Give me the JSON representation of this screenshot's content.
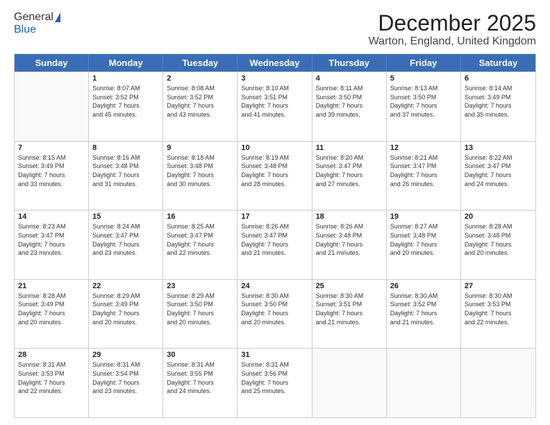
{
  "header": {
    "logo_general": "General",
    "logo_blue": "Blue",
    "month": "December 2025",
    "location": "Warton, England, United Kingdom"
  },
  "days_of_week": [
    "Sunday",
    "Monday",
    "Tuesday",
    "Wednesday",
    "Thursday",
    "Friday",
    "Saturday"
  ],
  "weeks": [
    [
      {
        "day": "",
        "lines": []
      },
      {
        "day": "1",
        "lines": [
          "Sunrise: 8:07 AM",
          "Sunset: 3:52 PM",
          "Daylight: 7 hours",
          "and 45 minutes."
        ]
      },
      {
        "day": "2",
        "lines": [
          "Sunrise: 8:08 AM",
          "Sunset: 3:52 PM",
          "Daylight: 7 hours",
          "and 43 minutes."
        ]
      },
      {
        "day": "3",
        "lines": [
          "Sunrise: 8:10 AM",
          "Sunset: 3:51 PM",
          "Daylight: 7 hours",
          "and 41 minutes."
        ]
      },
      {
        "day": "4",
        "lines": [
          "Sunrise: 8:11 AM",
          "Sunset: 3:50 PM",
          "Daylight: 7 hours",
          "and 39 minutes."
        ]
      },
      {
        "day": "5",
        "lines": [
          "Sunrise: 8:13 AM",
          "Sunset: 3:50 PM",
          "Daylight: 7 hours",
          "and 37 minutes."
        ]
      },
      {
        "day": "6",
        "lines": [
          "Sunrise: 8:14 AM",
          "Sunset: 3:49 PM",
          "Daylight: 7 hours",
          "and 35 minutes."
        ]
      }
    ],
    [
      {
        "day": "7",
        "lines": [
          "Sunrise: 8:15 AM",
          "Sunset: 3:49 PM",
          "Daylight: 7 hours",
          "and 33 minutes."
        ]
      },
      {
        "day": "8",
        "lines": [
          "Sunrise: 8:16 AM",
          "Sunset: 3:48 PM",
          "Daylight: 7 hours",
          "and 31 minutes."
        ]
      },
      {
        "day": "9",
        "lines": [
          "Sunrise: 8:18 AM",
          "Sunset: 3:48 PM",
          "Daylight: 7 hours",
          "and 30 minutes."
        ]
      },
      {
        "day": "10",
        "lines": [
          "Sunrise: 8:19 AM",
          "Sunset: 3:48 PM",
          "Daylight: 7 hours",
          "and 28 minutes."
        ]
      },
      {
        "day": "11",
        "lines": [
          "Sunrise: 8:20 AM",
          "Sunset: 3:47 PM",
          "Daylight: 7 hours",
          "and 27 minutes."
        ]
      },
      {
        "day": "12",
        "lines": [
          "Sunrise: 8:21 AM",
          "Sunset: 3:47 PM",
          "Daylight: 7 hours",
          "and 26 minutes."
        ]
      },
      {
        "day": "13",
        "lines": [
          "Sunrise: 8:22 AM",
          "Sunset: 3:47 PM",
          "Daylight: 7 hours",
          "and 24 minutes."
        ]
      }
    ],
    [
      {
        "day": "14",
        "lines": [
          "Sunrise: 8:23 AM",
          "Sunset: 3:47 PM",
          "Daylight: 7 hours",
          "and 23 minutes."
        ]
      },
      {
        "day": "15",
        "lines": [
          "Sunrise: 8:24 AM",
          "Sunset: 3:47 PM",
          "Daylight: 7 hours",
          "and 23 minutes."
        ]
      },
      {
        "day": "16",
        "lines": [
          "Sunrise: 8:25 AM",
          "Sunset: 3:47 PM",
          "Daylight: 7 hours",
          "and 22 minutes."
        ]
      },
      {
        "day": "17",
        "lines": [
          "Sunrise: 8:26 AM",
          "Sunset: 3:47 PM",
          "Daylight: 7 hours",
          "and 21 minutes."
        ]
      },
      {
        "day": "18",
        "lines": [
          "Sunrise: 8:26 AM",
          "Sunset: 3:48 PM",
          "Daylight: 7 hours",
          "and 21 minutes."
        ]
      },
      {
        "day": "19",
        "lines": [
          "Sunrise: 8:27 AM",
          "Sunset: 3:48 PM",
          "Daylight: 7 hours",
          "and 20 minutes."
        ]
      },
      {
        "day": "20",
        "lines": [
          "Sunrise: 8:28 AM",
          "Sunset: 3:48 PM",
          "Daylight: 7 hours",
          "and 20 minutes."
        ]
      }
    ],
    [
      {
        "day": "21",
        "lines": [
          "Sunrise: 8:28 AM",
          "Sunset: 3:49 PM",
          "Daylight: 7 hours",
          "and 20 minutes."
        ]
      },
      {
        "day": "22",
        "lines": [
          "Sunrise: 8:29 AM",
          "Sunset: 3:49 PM",
          "Daylight: 7 hours",
          "and 20 minutes."
        ]
      },
      {
        "day": "23",
        "lines": [
          "Sunrise: 8:29 AM",
          "Sunset: 3:50 PM",
          "Daylight: 7 hours",
          "and 20 minutes."
        ]
      },
      {
        "day": "24",
        "lines": [
          "Sunrise: 8:30 AM",
          "Sunset: 3:50 PM",
          "Daylight: 7 hours",
          "and 20 minutes."
        ]
      },
      {
        "day": "25",
        "lines": [
          "Sunrise: 8:30 AM",
          "Sunset: 3:51 PM",
          "Daylight: 7 hours",
          "and 21 minutes."
        ]
      },
      {
        "day": "26",
        "lines": [
          "Sunrise: 8:30 AM",
          "Sunset: 3:52 PM",
          "Daylight: 7 hours",
          "and 21 minutes."
        ]
      },
      {
        "day": "27",
        "lines": [
          "Sunrise: 8:30 AM",
          "Sunset: 3:53 PM",
          "Daylight: 7 hours",
          "and 22 minutes."
        ]
      }
    ],
    [
      {
        "day": "28",
        "lines": [
          "Sunrise: 8:31 AM",
          "Sunset: 3:53 PM",
          "Daylight: 7 hours",
          "and 22 minutes."
        ]
      },
      {
        "day": "29",
        "lines": [
          "Sunrise: 8:31 AM",
          "Sunset: 3:54 PM",
          "Daylight: 7 hours",
          "and 23 minutes."
        ]
      },
      {
        "day": "30",
        "lines": [
          "Sunrise: 8:31 AM",
          "Sunset: 3:55 PM",
          "Daylight: 7 hours",
          "and 24 minutes."
        ]
      },
      {
        "day": "31",
        "lines": [
          "Sunrise: 8:31 AM",
          "Sunset: 3:56 PM",
          "Daylight: 7 hours",
          "and 25 minutes."
        ]
      },
      {
        "day": "",
        "lines": []
      },
      {
        "day": "",
        "lines": []
      },
      {
        "day": "",
        "lines": []
      }
    ]
  ]
}
